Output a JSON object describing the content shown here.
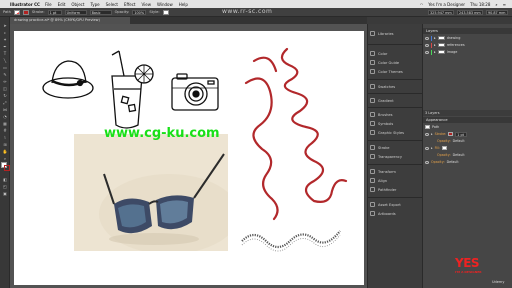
{
  "menubar": {
    "app_name": "Illustrator CC",
    "items": [
      "File",
      "Edit",
      "Object",
      "Type",
      "Select",
      "Effect",
      "View",
      "Window",
      "Help"
    ],
    "right_text": "Yes I'm a Designer",
    "clock": "Thu 18:28"
  },
  "controlbar": {
    "selection_label": "Path",
    "stroke_label": "Stroke:",
    "stroke_value": "1 pt",
    "profile_value": "Uniform",
    "brush_value": "Basic",
    "opacity_label": "Opacity:",
    "opacity_value": "100%",
    "style_label": "Style:",
    "x_value": "325.947 mm",
    "y_value": "243.583 mm",
    "w_value": "90.87 mm"
  },
  "document": {
    "tab_title": "drawing practice.ai* @ 89% (CMYK/GPU Preview)"
  },
  "dock": {
    "items": [
      {
        "label": "Libraries",
        "icon": "libraries-icon"
      },
      {
        "label": "Color",
        "icon": "color-icon"
      },
      {
        "label": "Color Guide",
        "icon": "color-guide-icon"
      },
      {
        "label": "Color Themes",
        "icon": "color-themes-icon"
      },
      {
        "label": "Swatches",
        "icon": "swatches-icon"
      },
      {
        "label": "Gradient",
        "icon": "gradient-icon"
      },
      {
        "label": "Brushes",
        "icon": "brushes-icon"
      },
      {
        "label": "Symbols",
        "icon": "symbols-icon"
      },
      {
        "label": "Graphic Styles",
        "icon": "graphic-styles-icon"
      },
      {
        "label": "Stroke",
        "icon": "stroke-icon"
      },
      {
        "label": "Transparency",
        "icon": "transparency-icon"
      },
      {
        "label": "Transform",
        "icon": "transform-icon"
      },
      {
        "label": "Align",
        "icon": "align-icon"
      },
      {
        "label": "Pathfinder",
        "icon": "pathfinder-icon"
      },
      {
        "label": "Asset Export",
        "icon": "asset-export-icon"
      },
      {
        "label": "Artboards",
        "icon": "artboards-icon"
      }
    ]
  },
  "layers_panel": {
    "title": "Layers",
    "layers": [
      {
        "name": "drawing",
        "color": "#4a7bd8"
      },
      {
        "name": "references",
        "color": "#d84a4a"
      },
      {
        "name": "Image",
        "color": "#4ad85a"
      }
    ],
    "count_text": "3 Layers"
  },
  "appearance_panel": {
    "title": "Appearance",
    "object_label": "Path",
    "stroke_label": "Stroke:",
    "stroke_weight": "1 pt",
    "opacity_label": "Opacity:",
    "opacity_value": "Default",
    "fill_label": "Fill:",
    "fill_opacity_label": "Opacity:",
    "fill_opacity_value": "Default",
    "outer_opacity_label": "Opacity:",
    "outer_opacity_value": "Default"
  },
  "watermarks": {
    "top": "www.rr-sc.com",
    "center": "www.cg-ku.com"
  },
  "branding": {
    "logo_big": "YES",
    "logo_small": "I'M A DESIGNER",
    "udemy": "Udemy"
  },
  "colors": {
    "accent_red": "#b22222",
    "canvas_bg": "#535353",
    "panel_bg": "#464646",
    "watermark_green": "#18e018"
  }
}
